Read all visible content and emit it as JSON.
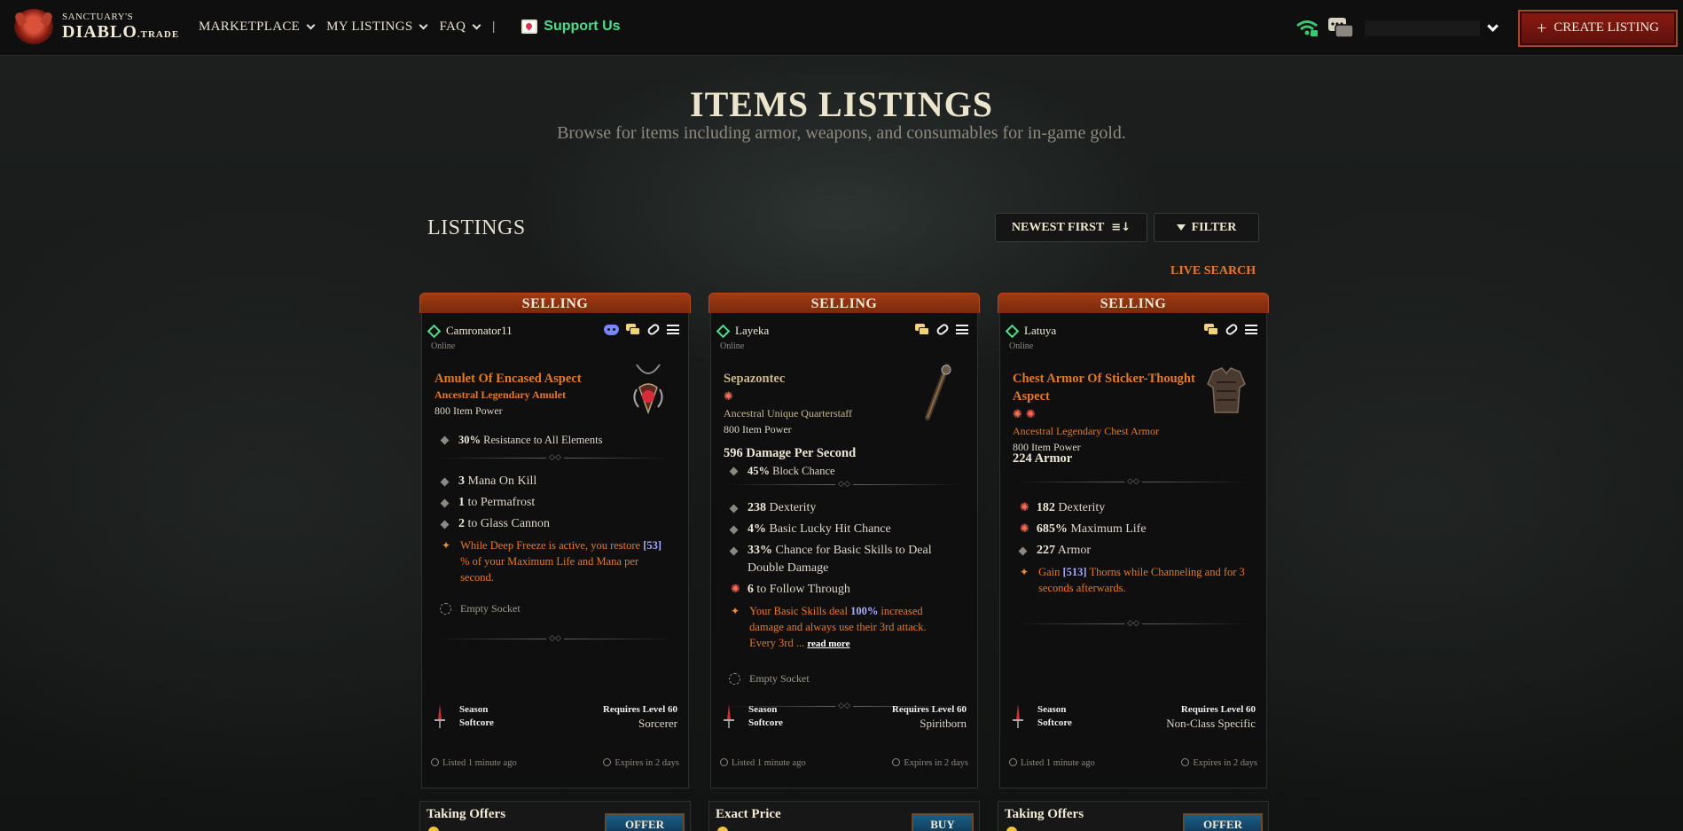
{
  "logo": {
    "line1": "SANCTUARY'S",
    "line2": "DIABLO",
    "line2_suffix": ".TRADE"
  },
  "nav": {
    "items": [
      {
        "label": "MARKETPLACE"
      },
      {
        "label": "MY LISTINGS"
      },
      {
        "label": "FAQ"
      }
    ],
    "separator": "|",
    "support_label": "Support Us",
    "create_listing_label": "CREATE LISTING"
  },
  "hero": {
    "title": "ITEMS LISTINGS",
    "subtitle": "Browse for items including armor, weapons, and consumables for in-game gold."
  },
  "toolbar": {
    "listings_heading": "LISTINGS",
    "sort_label": "NEWEST FIRST",
    "filter_label": "FILTER",
    "live_search_label": "LIVE SEARCH"
  },
  "colors": {
    "accent_orange": "#e37a1f",
    "online_green": "#4fe08a",
    "selling_tab": "#a03a14",
    "support_green": "#4ddc8a"
  },
  "cards": [
    {
      "tab": "SELLING",
      "user": "Camronator11",
      "status": "Online",
      "item_name": "Amulet Of Encased Aspect",
      "item_type": "Ancestral Legendary Amulet",
      "item_power": "800 Item Power",
      "implicit": {
        "value": "30%",
        "text": " Resistance to All Elements"
      },
      "affixes": [
        {
          "value": "3",
          "text": " Mana On Kill"
        },
        {
          "value": "1",
          "text": " to Permafrost"
        },
        {
          "value": "2",
          "text": " to Glass Cannon"
        }
      ],
      "aspect": {
        "pre": "While Deep Freeze is active, you restore ",
        "hl": "[53]",
        "post": " % of your Maximum Life and Mana per second."
      },
      "socket": "Empty Socket",
      "season": "Season",
      "mode": "Softcore",
      "req_level": "Requires Level 60",
      "class": "Sorcerer",
      "listed": "Listed 1 minute ago",
      "expires": "Expires in 2 days",
      "price_type": "Taking Offers",
      "action": "OFFER"
    },
    {
      "tab": "SELLING",
      "user": "Layeka",
      "status": "Online",
      "item_name": "Sepazontec",
      "item_type": "Ancestral Unique Quarterstaff",
      "item_power": "800 Item Power",
      "dps": "596 Damage Per Second",
      "implicit": {
        "value": "45%",
        "text": " Block Chance"
      },
      "affixes": [
        {
          "value": "238",
          "text": " Dexterity"
        },
        {
          "value": "4%",
          "text": " Basic Lucky Hit Chance"
        },
        {
          "value": "33%",
          "text": " Chance for Basic Skills to Deal Double Damage"
        },
        {
          "value": "6",
          "text": " to Follow Through"
        }
      ],
      "aspect": {
        "pre": "Your Basic Skills deal ",
        "hl": "100%",
        "post": " increased damage and always use their 3rd attack. Every 3rd ..."
      },
      "read_more": "read more",
      "socket": "Empty Socket",
      "season": "Season",
      "mode": "Softcore",
      "req_level": "Requires Level 60",
      "class": "Spiritborn",
      "listed": "Listed 1 minute ago",
      "expires": "Expires in 2 days",
      "price_type": "Exact Price",
      "action": "BUY"
    },
    {
      "tab": "SELLING",
      "user": "Latuya",
      "status": "Online",
      "item_name": "Chest Armor Of Sticker-Thought Aspect",
      "item_type": "Ancestral Legendary Chest Armor",
      "item_power": "800 Item Power",
      "armor": "224 Armor",
      "affixes": [
        {
          "value": "182",
          "text": " Dexterity"
        },
        {
          "value": "685%",
          "text": " Maximum Life"
        },
        {
          "value": "227",
          "text": " Armor"
        }
      ],
      "aspect": {
        "pre": "Gain ",
        "hl": "[513]",
        "post": " Thorns while Channeling and for 3 seconds afterwards."
      },
      "season": "Season",
      "mode": "Softcore",
      "req_level": "Requires Level 60",
      "class": "Non-Class Specific",
      "listed": "Listed 1 minute ago",
      "expires": "Expires in 2 days",
      "price_type": "Taking Offers",
      "action": "OFFER"
    }
  ]
}
